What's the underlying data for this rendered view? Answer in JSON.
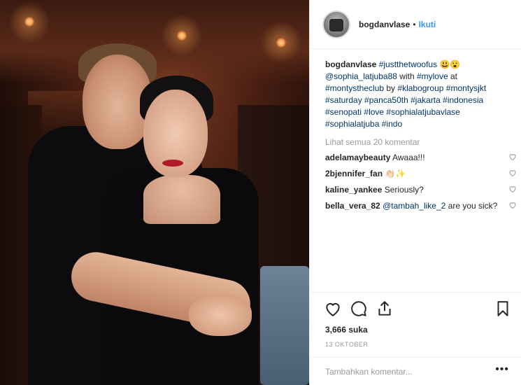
{
  "header": {
    "username": "bogdanvlase",
    "separator": "•",
    "follow_label": "Ikuti",
    "avatar_icon": "profile-avatar"
  },
  "caption": {
    "username": "bogdanvlase",
    "hashtag1": "#justthetwoofus",
    "emoji": "😃😮",
    "mention": "@sophia_latjuba88",
    "with": " with ",
    "hashtag2": "#mylove",
    "at": " at",
    "hashtag3": "#montystheclub",
    "by": " by ",
    "hashtag4": "#klabogroup",
    "hashtag5": "#montysjkt",
    "hashtag6": "#saturday",
    "hashtag7": "#panca50th",
    "hashtag8": "#jakarta",
    "hashtag9": "#indonesia",
    "hashtag10": "#senopati",
    "hashtag11": "#love",
    "hashtag12": "#sophialatjubavlase",
    "hashtag13": "#sophialatjuba",
    "hashtag14": "#indo"
  },
  "view_all": "Lihat semua 20 komentar",
  "comments": [
    {
      "user": "adelamaybeauty",
      "text": "Awaaa!!!"
    },
    {
      "user": "2bjennifer_fan",
      "text": "👏🏻✨"
    },
    {
      "user": "kaline_yankee",
      "text": "Seriously?"
    },
    {
      "user": "bella_vera_82",
      "mention": "@tambah_like_2",
      "text": "are you sick?"
    }
  ],
  "actions": {
    "like_icon": "heart-icon",
    "comment_icon": "comment-icon",
    "share_icon": "share-icon",
    "save_icon": "bookmark-icon"
  },
  "likes": "3,666 suka",
  "date": "13 OKTOBER",
  "add_comment_placeholder": "Tambahkan komentar...",
  "more_label": "•••",
  "colors": {
    "link_blue": "#3897f0",
    "hashtag": "#003569",
    "muted": "#999999",
    "text": "#262626",
    "border": "#efefef"
  }
}
